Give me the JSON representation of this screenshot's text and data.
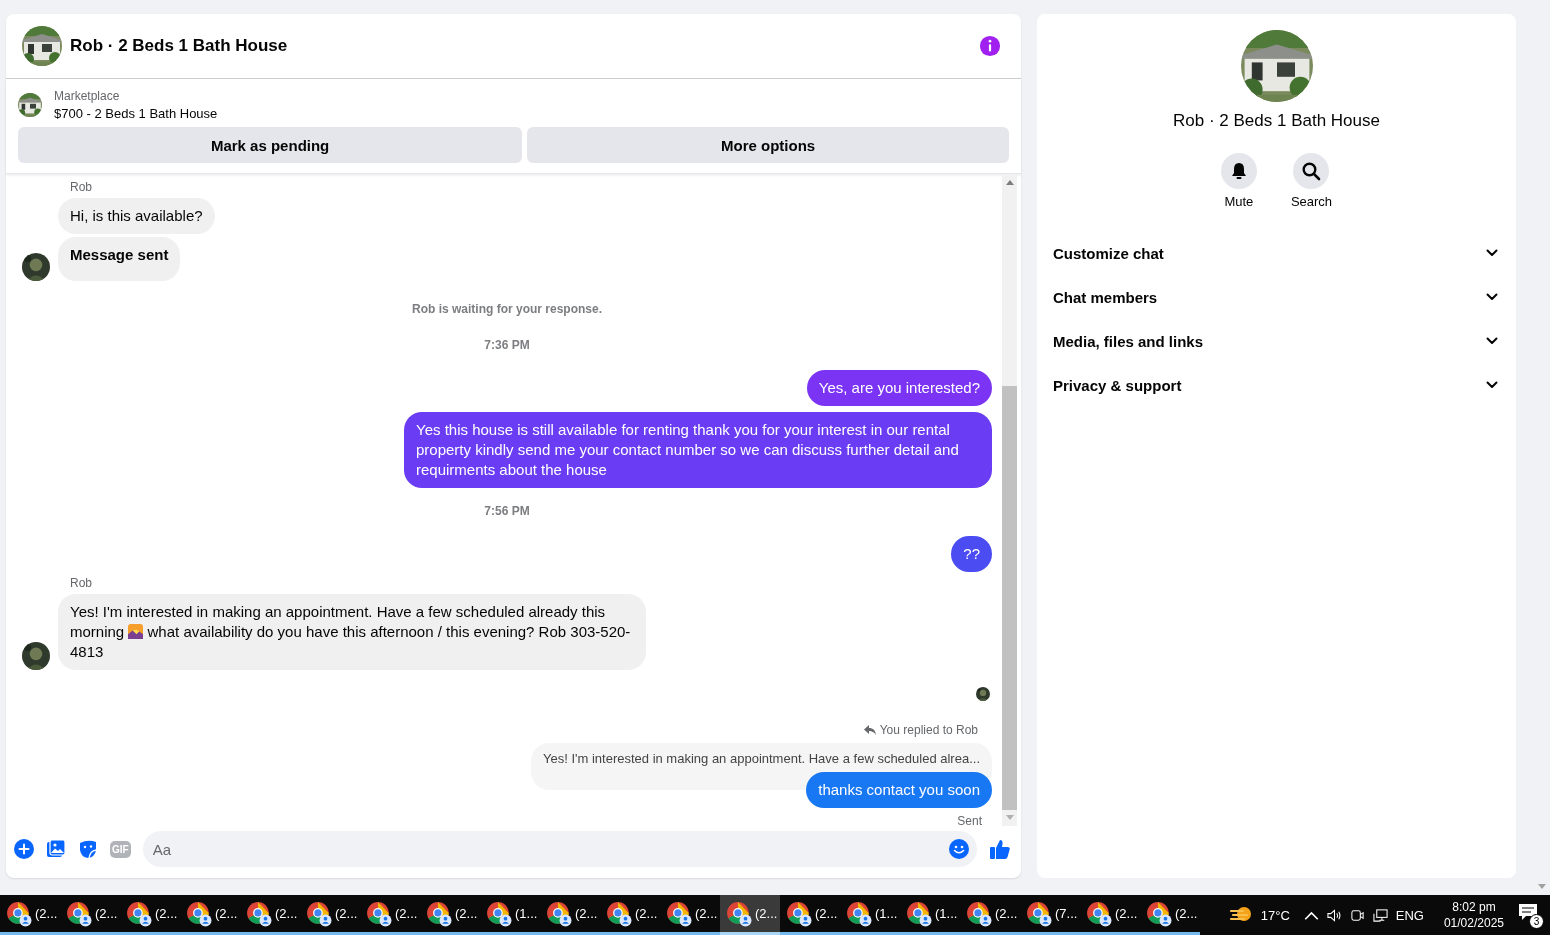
{
  "chat": {
    "title": "Rob · 2 Beds 1 Bath House",
    "listing": {
      "source": "Marketplace",
      "title": "$700 - 2 Beds 1 Bath House"
    },
    "actions": [
      "Mark as pending",
      "More options"
    ],
    "messages": [
      {
        "kind": "sender",
        "text": "Rob"
      },
      {
        "kind": "incoming",
        "text": "Hi, is this available?",
        "avatar": false
      },
      {
        "kind": "incoming",
        "text": "Message sent",
        "bold": true,
        "avatar": true
      },
      {
        "kind": "status",
        "text": "Rob is waiting for your response."
      },
      {
        "kind": "time",
        "text": "7:36 PM"
      },
      {
        "kind": "outgoing",
        "text": "Yes, are you interested?",
        "color": "#7b33f4"
      },
      {
        "kind": "outgoing",
        "text": "Yes this house is still available for renting thank you for your interest in our rental property kindly send me your contact number so we can discuss further detail and requirments about the house",
        "color": "#6a3cf3"
      },
      {
        "kind": "time",
        "text": "7:56 PM"
      },
      {
        "kind": "outgoing",
        "text": "??",
        "color": "#4b4cf1"
      },
      {
        "kind": "sender",
        "text": "Rob"
      },
      {
        "kind": "incoming",
        "text": "Yes! I'm interested in making an appointment. Have a few scheduled already this morning",
        "text_after": "what availability do you have this afternoon / this evening? Rob 303-520-4813",
        "avatar": true
      },
      {
        "kind": "seen"
      },
      {
        "kind": "reply_label",
        "text": "You replied to Rob"
      },
      {
        "kind": "reply_quote",
        "text": "Yes! I'm interested in making an appointment. Have a few scheduled alrea..."
      },
      {
        "kind": "outgoing",
        "text": "thanks contact you soon",
        "color": "#1877f2"
      },
      {
        "kind": "sent_status",
        "text": "Sent"
      }
    ],
    "composer": {
      "gif": "GIF",
      "placeholder": "Aa"
    }
  },
  "details": {
    "title": "Rob · 2 Beds 1 Bath House",
    "actions": [
      {
        "kind": "mute",
        "label": "Mute"
      },
      {
        "kind": "search",
        "label": "Search"
      }
    ],
    "sections": [
      {
        "label": "Customize chat",
        "expanded": false
      },
      {
        "label": "Chat members",
        "expanded": false
      },
      {
        "label": "Media, files and links",
        "expanded": false
      },
      {
        "label": "Privacy & support",
        "expanded": false
      }
    ]
  },
  "taskbar": {
    "apps": [
      {
        "label": "(2...",
        "selected": false
      },
      {
        "label": "(2...",
        "selected": false
      },
      {
        "label": "(2...",
        "selected": false
      },
      {
        "label": "(2...",
        "selected": false
      },
      {
        "label": "(2...",
        "selected": false
      },
      {
        "label": "(2...",
        "selected": false
      },
      {
        "label": "(2...",
        "selected": false
      },
      {
        "label": "(2...",
        "selected": false
      },
      {
        "label": "(1...",
        "selected": false
      },
      {
        "label": "(2...",
        "selected": false
      },
      {
        "label": "(2...",
        "selected": false
      },
      {
        "label": "(2...",
        "selected": false
      },
      {
        "label": "(2...",
        "selected": true
      },
      {
        "label": "(2...",
        "selected": false
      },
      {
        "label": "(1...",
        "selected": false
      },
      {
        "label": "(1...",
        "selected": false
      },
      {
        "label": "(2...",
        "selected": false
      },
      {
        "label": "(7...",
        "selected": false
      },
      {
        "label": "(2...",
        "selected": false
      },
      {
        "label": "(2...",
        "selected": false
      }
    ],
    "temperature": "17°C",
    "language": "ENG",
    "time": "8:02 pm",
    "date": "01/02/2025",
    "notifications": "3"
  }
}
